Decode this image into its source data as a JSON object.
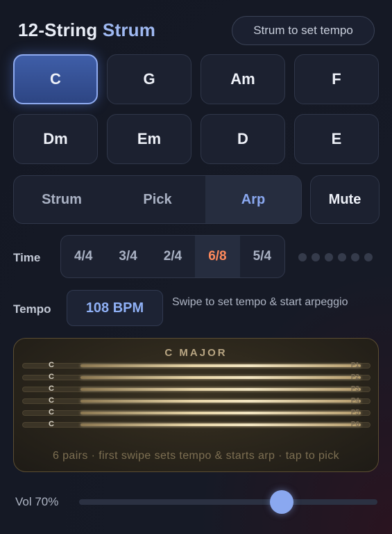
{
  "header": {
    "title_prefix": "12-String ",
    "title_accent": "Strum",
    "tempo_button": "Strum to set tempo"
  },
  "chords": [
    {
      "label": "C",
      "active": true
    },
    {
      "label": "G",
      "active": false
    },
    {
      "label": "Am",
      "active": false
    },
    {
      "label": "F",
      "active": false
    },
    {
      "label": "Dm",
      "active": false
    },
    {
      "label": "Em",
      "active": false
    },
    {
      "label": "D",
      "active": false
    },
    {
      "label": "E",
      "active": false
    }
  ],
  "modes": {
    "items": [
      "Strum",
      "Pick",
      "Arp"
    ],
    "selected": "Arp",
    "mute_label": "Mute"
  },
  "time": {
    "label": "Time",
    "items": [
      "4/4",
      "3/4",
      "2/4",
      "6/8",
      "5/4"
    ],
    "selected": "6/8"
  },
  "tempo": {
    "label": "Tempo",
    "bpm": "108 BPM",
    "hint": "Swipe to set tempo & start arpeggio"
  },
  "strum_panel": {
    "title": "C MAJOR",
    "hint": "6 pairs · first swipe sets tempo & starts arp · tap to pick",
    "strings": [
      {
        "note": "C",
        "tag": "P1"
      },
      {
        "note": "C",
        "tag": "P2"
      },
      {
        "note": "C",
        "tag": "P3"
      },
      {
        "note": "C",
        "tag": "P4"
      },
      {
        "note": "C",
        "tag": "P5"
      },
      {
        "note": "C",
        "tag": "P6"
      }
    ]
  },
  "volume": {
    "label": "Vol 70%",
    "level": 0.68
  },
  "colors": {
    "accent": "#8aa8f0",
    "time_selected": "#ff8a5c",
    "panel_gold": "#b8a582"
  }
}
